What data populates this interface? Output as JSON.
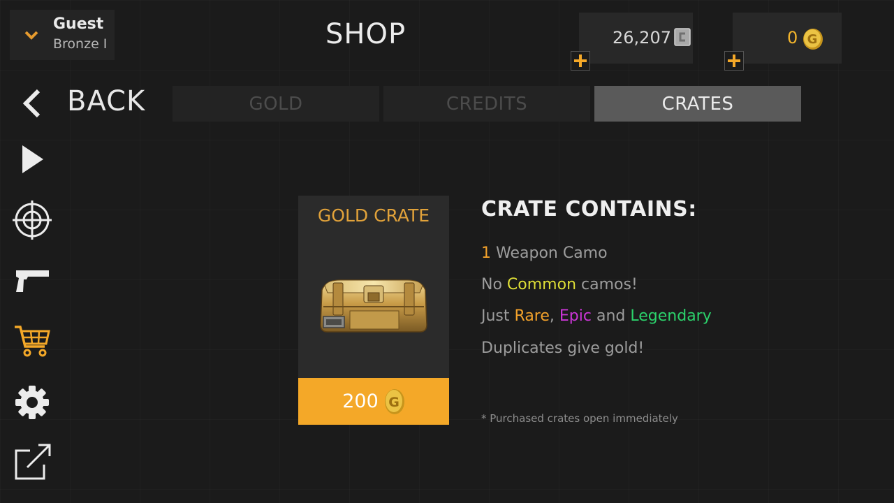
{
  "profile": {
    "name": "Guest",
    "rank": "Bronze I"
  },
  "header": {
    "title": "SHOP"
  },
  "currency": {
    "credits": {
      "value": "26,207",
      "icon": "credit-icon"
    },
    "gold": {
      "value": "0",
      "icon": "gold-coin-icon"
    }
  },
  "nav": {
    "back_label": "BACK",
    "icons": [
      "back-arrow-icon",
      "play-icon",
      "crosshair-icon",
      "pistol-icon",
      "cart-icon",
      "gear-icon",
      "external-link-icon"
    ]
  },
  "tabs": [
    {
      "label": "GOLD",
      "active": false
    },
    {
      "label": "CREDITS",
      "active": false
    },
    {
      "label": "CRATES",
      "active": true
    }
  ],
  "crate": {
    "title": "GOLD CRATE",
    "price": "200"
  },
  "contents": {
    "title": "CRATE CONTAINS:",
    "line1": {
      "count": "1",
      "text": " Weapon Camo"
    },
    "line2": {
      "pre": "No ",
      "highlight": "Common",
      "post": " camos!"
    },
    "line3": {
      "pre": "Just ",
      "rare": "Rare",
      "comma": ", ",
      "epic": "Epic",
      "and": " and ",
      "legendary": "Legendary"
    },
    "line4": "Duplicates give gold!",
    "note": "* Purchased crates open immediately"
  },
  "colors": {
    "accent": "#f4a828",
    "rare": "#f3a22b",
    "common": "#dede36",
    "epic": "#cc36d8",
    "legendary": "#2bd26b"
  }
}
